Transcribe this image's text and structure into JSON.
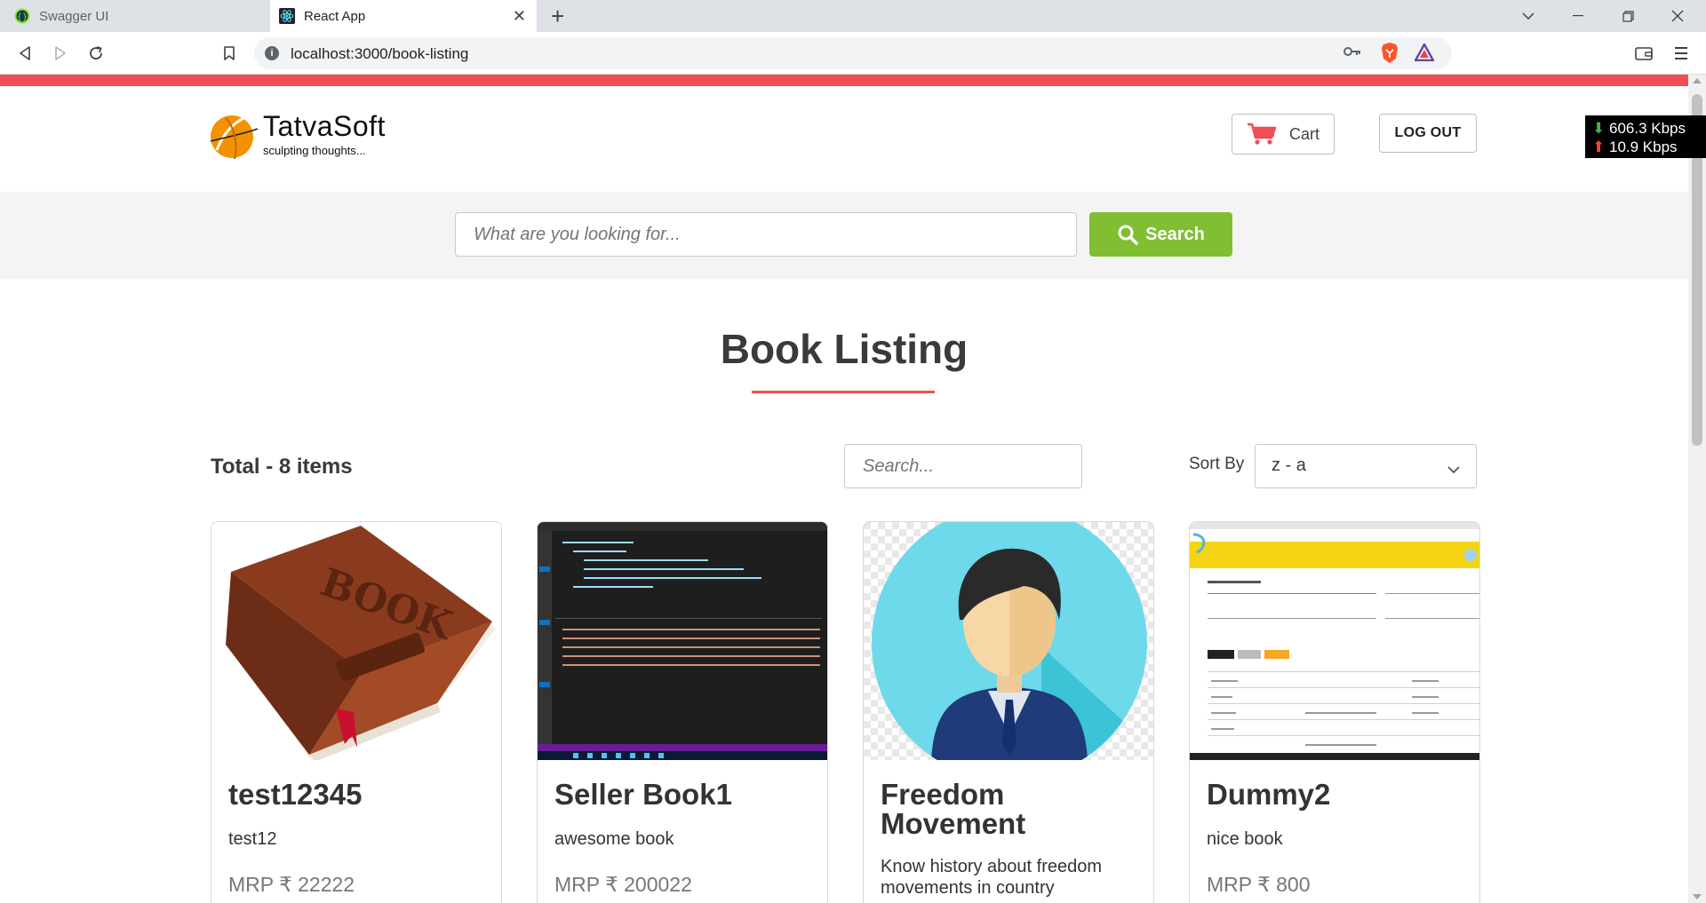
{
  "browser": {
    "tabs": [
      {
        "title": "Swagger UI",
        "active": false
      },
      {
        "title": "React App",
        "active": true
      }
    ],
    "url": "localhost:3000/book-listing"
  },
  "header": {
    "brand": "TatvaSoft",
    "tagline": "sculpting thoughts...",
    "cart_label": "Cart",
    "logout_label": "LOG OUT"
  },
  "search": {
    "placeholder": "What are you looking for...",
    "button_label": "Search"
  },
  "speed": {
    "down": "606.3 Kbps",
    "up": "10.9 Kbps"
  },
  "listing": {
    "title": "Book Listing",
    "total": "Total - 8 items",
    "filter_placeholder": "Search...",
    "sort_label": "Sort By",
    "sort_value": "z - a"
  },
  "books": [
    {
      "name": "test12345",
      "description": "test12",
      "price": "MRP ₹ 22222"
    },
    {
      "name": "Seller Book1",
      "description": "awesome book",
      "price": "MRP ₹ 200022"
    },
    {
      "name": "Freedom Movement",
      "description": "Know history about freedom movements in country",
      "price": ""
    },
    {
      "name": "Dummy2",
      "description": "nice book",
      "price": "MRP ₹ 800"
    }
  ],
  "colors": {
    "accent": "#f14d54",
    "search_button": "#80bf31",
    "logo_orange": "#f39200"
  }
}
